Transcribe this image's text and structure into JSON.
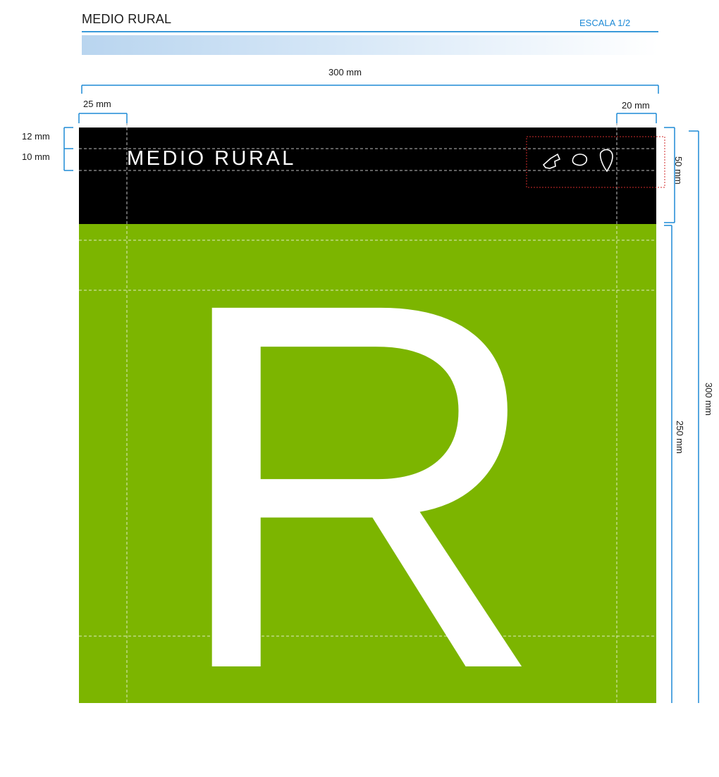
{
  "header": {
    "title": "MEDIO RURAL",
    "scale": "ESCALA 1/2"
  },
  "dimensions": {
    "width_total": "300 mm",
    "left_margin": "25 mm",
    "right_margin": "20 mm",
    "top_offset": "12 mm",
    "text_height": "10 mm",
    "band_height": "50 mm",
    "lower_height": "250 mm",
    "total_height": "300 mm"
  },
  "sign": {
    "title": "MEDIO RURAL",
    "letter": "R",
    "band_color": "#000000",
    "body_color": "#7cb500",
    "icons": [
      "island-icon",
      "island-icon",
      "island-icon"
    ]
  },
  "colors": {
    "accent": "#1e8ad6"
  }
}
